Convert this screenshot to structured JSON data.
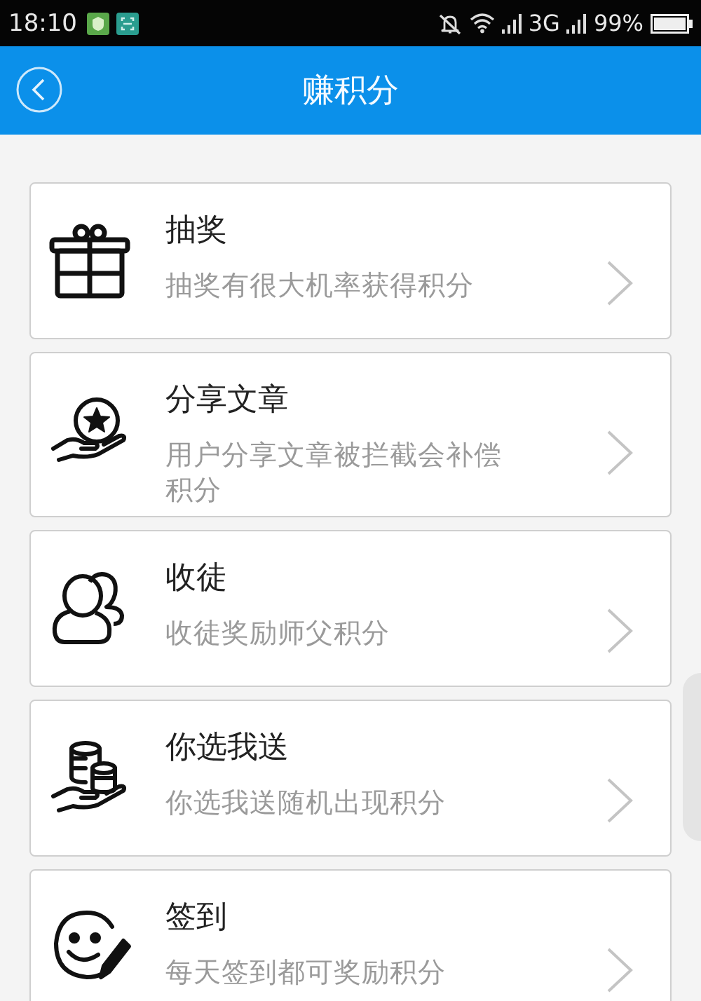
{
  "status_bar": {
    "time": "18:10",
    "network": "3G",
    "battery": "99%"
  },
  "header": {
    "title": "赚积分"
  },
  "items": [
    {
      "kind": "gift",
      "title": "抽奖",
      "subtitle": "抽奖有很大机率获得积分"
    },
    {
      "kind": "share",
      "title": "分享文章",
      "subtitle": "用户分享文章被拦截会补偿积分"
    },
    {
      "kind": "disciples",
      "title": "收徒",
      "subtitle": "收徒奖励师父积分"
    },
    {
      "kind": "coins",
      "title": "你选我送",
      "subtitle": "你选我送随机出现积分"
    },
    {
      "kind": "sign",
      "title": "签到",
      "subtitle": "每天签到都可奖励积分"
    }
  ]
}
